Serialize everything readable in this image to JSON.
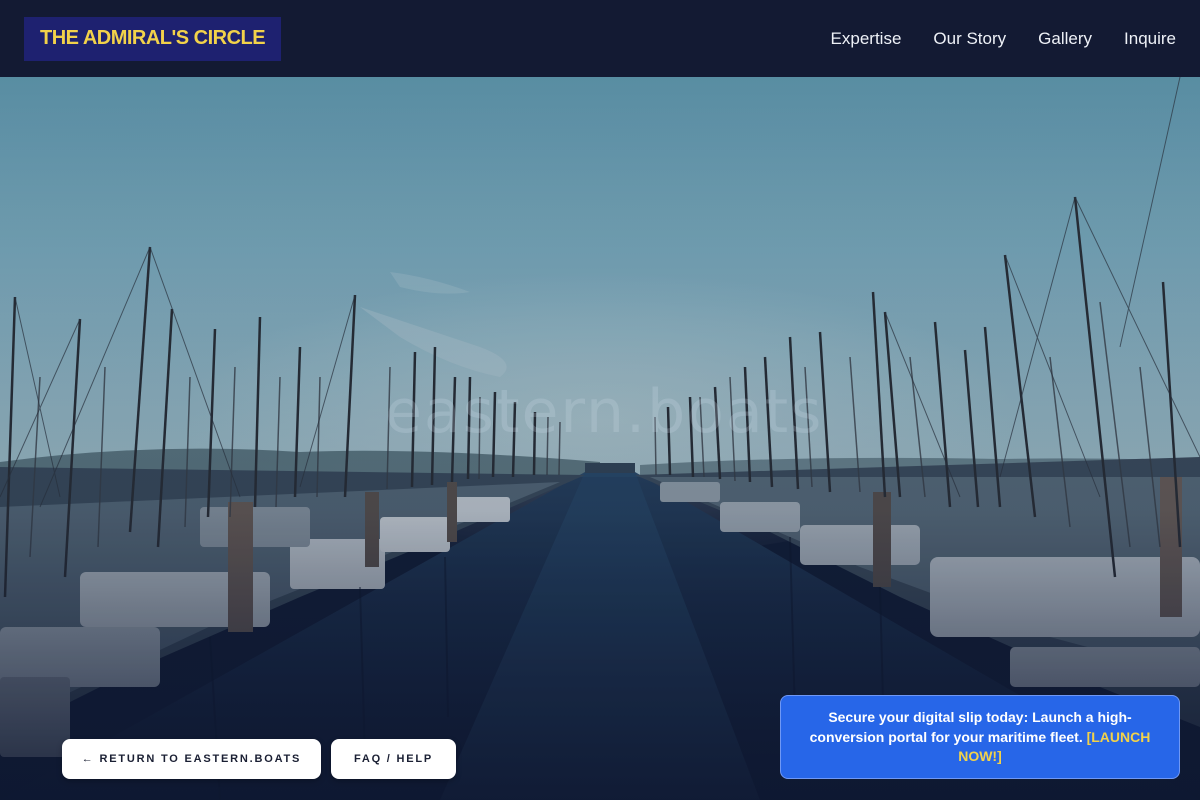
{
  "header": {
    "logo_text": "THE ADMIRAL'S CIRCLE",
    "nav": [
      {
        "label": "Expertise"
      },
      {
        "label": "Our Story"
      },
      {
        "label": "Gallery"
      },
      {
        "label": "Inquire"
      }
    ]
  },
  "hero": {
    "watermark_text": "eastern.boats"
  },
  "buttons": {
    "return_label": "← RETURN TO EASTERN.BOATS",
    "faq_label": "FAQ / HELP"
  },
  "promo": {
    "text": "Secure your digital slip today: Launch a high-conversion portal for your maritime fleet.",
    "cta": "[LAUNCH NOW!]"
  },
  "colors": {
    "header_bg": "#131a33",
    "logo_bg": "#1e2170",
    "logo_text": "#f2d24a",
    "promo_bg": "#2766e8",
    "cta_accent": "#f2d24a"
  }
}
